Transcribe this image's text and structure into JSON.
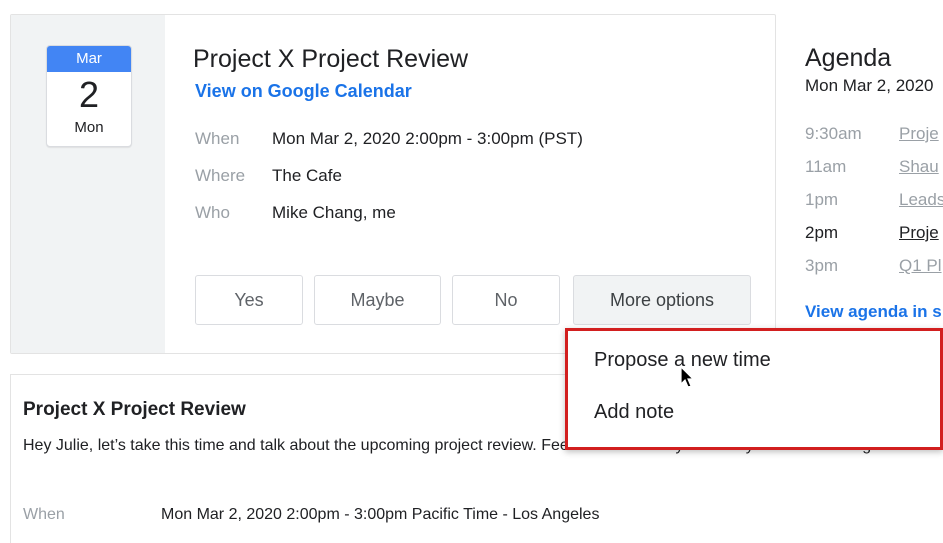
{
  "event": {
    "date_badge": {
      "month": "Mar",
      "day": "2",
      "weekday": "Mon"
    },
    "title": "Project X Project Review",
    "view_link": "View on Google Calendar",
    "details": {
      "when_label": "When",
      "when_value": "Mon Mar 2, 2020 2:00pm - 3:00pm (PST)",
      "where_label": "Where",
      "where_value": "The Cafe",
      "who_label": "Who",
      "who_value": "Mike Chang, me"
    },
    "rsvp": {
      "yes": "Yes",
      "maybe": "Maybe",
      "no": "No",
      "more": "More options"
    }
  },
  "agenda": {
    "title": "Agenda",
    "date": "Mon Mar 2, 2020",
    "items": [
      {
        "time": "9:30am",
        "event": "Proje"
      },
      {
        "time": "11am",
        "event": "Shau"
      },
      {
        "time": "1pm",
        "event": "Leads"
      },
      {
        "time": "2pm",
        "event": "Proje"
      },
      {
        "time": "3pm",
        "event": "Q1 Pl"
      }
    ],
    "view_link": "View agenda in s"
  },
  "menu": {
    "items": [
      "Propose a new time",
      "Add note"
    ]
  },
  "message": {
    "title": "Project X Project Review",
    "text": "Hey Julie, let’s take this time and talk about the upcoming project review. Feel free to add anyone that you think meeting",
    "when_label": "When",
    "when_value": "Mon Mar 2, 2020 2:00pm - 3:00pm Pacific Time - Los Angeles"
  },
  "colors": {
    "accent_blue": "#1a73e8",
    "badge_blue": "#4285f4",
    "highlight_red": "#d21f1f"
  }
}
